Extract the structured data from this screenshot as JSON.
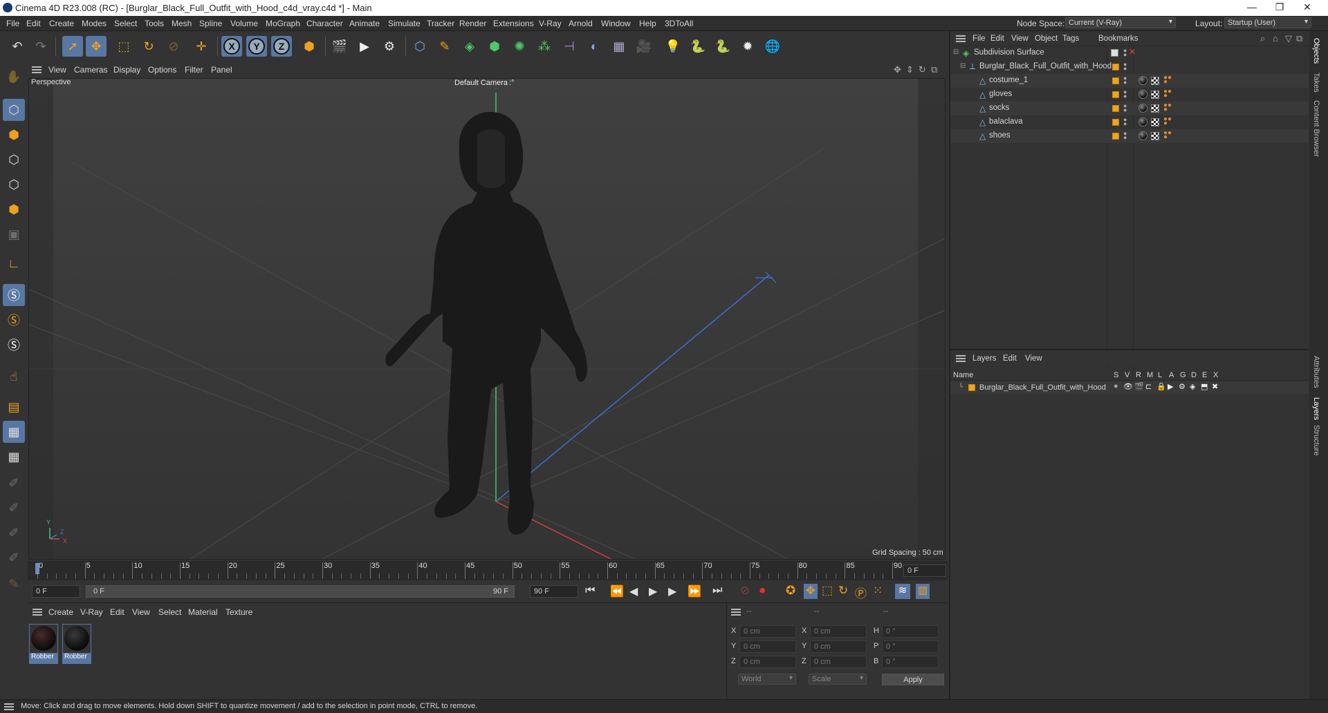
{
  "window": {
    "title": "Cinema 4D R23.008 (RC) - [Burglar_Black_Full_Outfit_with_Hood_c4d_vray.c4d *] - Main",
    "minimize": "—",
    "maximize": "❐",
    "close": "✕"
  },
  "menubar": {
    "items": [
      "File",
      "Edit",
      "Create",
      "Modes",
      "Select",
      "Tools",
      "Mesh",
      "Spline",
      "Volume",
      "MoGraph",
      "Character",
      "Animate",
      "Simulate",
      "Tracker",
      "Render",
      "Extensions",
      "V-Ray",
      "Arnold",
      "Window",
      "Help",
      "3DToAll"
    ],
    "node_space_label": "Node Space:",
    "node_space_value": "Current (V-Ray)",
    "layout_label": "Layout:",
    "layout_value": "Startup (User)"
  },
  "toolbar": {
    "axis_x": "X",
    "axis_y": "Y",
    "axis_z": "Z"
  },
  "viewport": {
    "menu": [
      "View",
      "Cameras",
      "Display",
      "Options",
      "Filter",
      "Panel"
    ],
    "label": "Perspective",
    "camera": "Default Camera",
    "camera_mark": ":°",
    "grid_spacing": "Grid Spacing : 50 cm",
    "axis_x": "X",
    "axis_y": "Y",
    "axis_z": "Z"
  },
  "timeline": {
    "ticks": [
      "0",
      "5",
      "10",
      "15",
      "20",
      "25",
      "30",
      "35",
      "40",
      "45",
      "50",
      "55",
      "60",
      "65",
      "70",
      "75",
      "80",
      "85",
      "90"
    ],
    "current_frame": "0 F",
    "start_field": "0 F",
    "range_start": "0 F",
    "range_end": "90 F",
    "end_field": "90 F",
    "playhead_fraction": 0
  },
  "materials": {
    "menu": [
      "Create",
      "V-Ray",
      "Edit",
      "View",
      "Select",
      "Material",
      "Texture"
    ],
    "items": [
      {
        "label": "Robber"
      },
      {
        "label": "Robber"
      }
    ]
  },
  "coords": {
    "headers": [
      "--",
      "--",
      "--"
    ],
    "rows": [
      {
        "axis": "X",
        "pos": "0 cm",
        "axis2": "X",
        "size": "0 cm",
        "rot_label": "H",
        "rot": "0 °"
      },
      {
        "axis": "Y",
        "pos": "0 cm",
        "axis2": "Y",
        "size": "0 cm",
        "rot_label": "P",
        "rot": "0 °"
      },
      {
        "axis": "Z",
        "pos": "0 cm",
        "axis2": "Z",
        "size": "0 cm",
        "rot_label": "B",
        "rot": "0 °"
      }
    ],
    "mode_world": "World",
    "mode_scale": "Scale",
    "apply": "Apply"
  },
  "object_manager": {
    "menu": [
      "File",
      "Edit",
      "View",
      "Object",
      "Tags",
      "Bookmarks"
    ],
    "objects": [
      {
        "name": "Subdivision Surface",
        "level": 0,
        "type": "subdivision"
      },
      {
        "name": "Burglar_Black_Full_Outfit_with_Hood",
        "level": 1,
        "type": "null"
      },
      {
        "name": "costume_1",
        "level": 2,
        "type": "mesh"
      },
      {
        "name": "gloves",
        "level": 2,
        "type": "mesh"
      },
      {
        "name": "socks",
        "level": 2,
        "type": "mesh"
      },
      {
        "name": "balaclava",
        "level": 2,
        "type": "mesh"
      },
      {
        "name": "shoes",
        "level": 2,
        "type": "mesh"
      }
    ]
  },
  "layers_manager": {
    "menu": [
      "Layers",
      "Edit",
      "View"
    ],
    "name_header": "Name",
    "columns": [
      "S",
      "V",
      "R",
      "M",
      "L",
      "A",
      "G",
      "D",
      "E",
      "X"
    ],
    "layers": [
      {
        "name": "Burglar_Black_Full_Outfit_with_Hood",
        "color": "#f1a41c"
      }
    ]
  },
  "side_tabs": [
    "Objects",
    "Takes",
    "Content Browser",
    "Attributes",
    "Layers",
    "Structure"
  ],
  "status": {
    "text": "Move: Click and drag to move elements. Hold down SHIFT to quantize movement / add to the selection in point mode, CTRL to remove."
  },
  "colors": {
    "accent": "#5877a3",
    "object_orange": "#f1a41c",
    "background": "#333333"
  }
}
